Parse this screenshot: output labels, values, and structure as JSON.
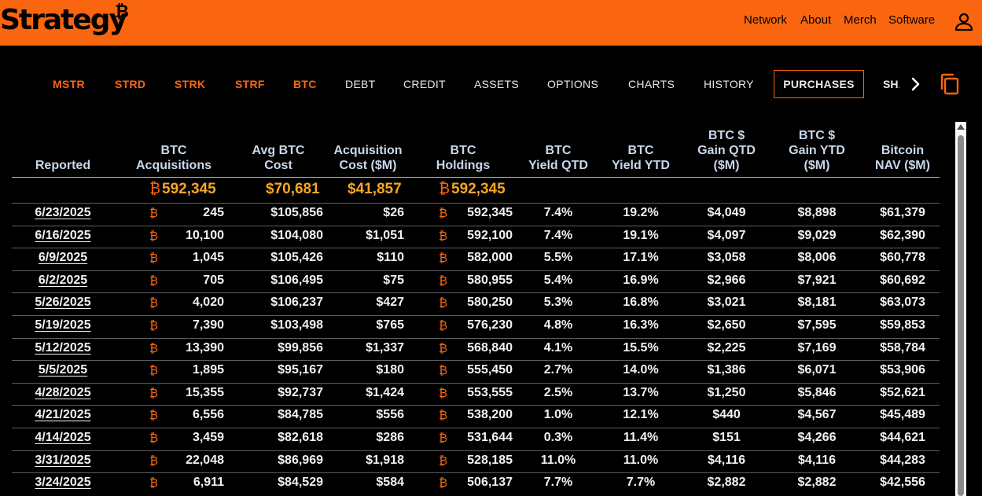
{
  "brand": {
    "name": "Strategy",
    "mark": "₿",
    "color": "#fa660f"
  },
  "topnav": [
    "Network",
    "About",
    "Merch",
    "Software"
  ],
  "icons": {
    "user": "user-icon",
    "next": "chevron-right-icon",
    "copy": "copy-icon",
    "bitcoin": "bitcoin-icon"
  },
  "tabs": [
    {
      "label": "MSTR"
    },
    {
      "label": "STRD"
    },
    {
      "label": "STRK"
    },
    {
      "label": "STRF"
    },
    {
      "label": "BTC"
    },
    {
      "label": "DEBT"
    },
    {
      "label": "CREDIT"
    },
    {
      "label": "ASSETS"
    },
    {
      "label": "OPTIONS"
    },
    {
      "label": "CHARTS"
    },
    {
      "label": "HISTORY"
    },
    {
      "label": "PURCHASES",
      "active": true
    },
    {
      "label": "SHARES",
      "clipped": "SH..."
    }
  ],
  "table": {
    "headers": [
      "Reported",
      "BTC\nAcquisitions",
      "Avg BTC\nCost",
      "Acquisition\nCost ($M)",
      "BTC\nHoldings",
      "BTC\nYield QTD",
      "BTC\nYield YTD",
      "BTC $\nGain QTD\n($M)",
      "BTC $\nGain YTD\n($M)",
      "Bitcoin\nNAV ($M)"
    ],
    "totals": {
      "acquisitions": "592,345",
      "avg_cost": "$70,681",
      "acq_cost": "$41,857",
      "holdings": "592,345"
    },
    "rows": [
      [
        "6/23/2025",
        "245",
        "$105,856",
        "$26",
        "592,345",
        "7.4%",
        "19.2%",
        "$4,049",
        "$8,898",
        "$61,379"
      ],
      [
        "6/16/2025",
        "10,100",
        "$104,080",
        "$1,051",
        "592,100",
        "7.4%",
        "19.1%",
        "$4,097",
        "$9,029",
        "$62,390"
      ],
      [
        "6/9/2025",
        "1,045",
        "$105,426",
        "$110",
        "582,000",
        "5.5%",
        "17.1%",
        "$3,058",
        "$8,006",
        "$60,778"
      ],
      [
        "6/2/2025",
        "705",
        "$106,495",
        "$75",
        "580,955",
        "5.4%",
        "16.9%",
        "$2,966",
        "$7,921",
        "$60,692"
      ],
      [
        "5/26/2025",
        "4,020",
        "$106,237",
        "$427",
        "580,250",
        "5.3%",
        "16.8%",
        "$3,021",
        "$8,181",
        "$63,073"
      ],
      [
        "5/19/2025",
        "7,390",
        "$103,498",
        "$765",
        "576,230",
        "4.8%",
        "16.3%",
        "$2,650",
        "$7,595",
        "$59,853"
      ],
      [
        "5/12/2025",
        "13,390",
        "$99,856",
        "$1,337",
        "568,840",
        "4.1%",
        "15.5%",
        "$2,225",
        "$7,169",
        "$58,784"
      ],
      [
        "5/5/2025",
        "1,895",
        "$95,167",
        "$180",
        "555,450",
        "2.7%",
        "14.0%",
        "$1,386",
        "$6,071",
        "$53,906"
      ],
      [
        "4/28/2025",
        "15,355",
        "$92,737",
        "$1,424",
        "553,555",
        "2.5%",
        "13.7%",
        "$1,250",
        "$5,846",
        "$52,621"
      ],
      [
        "4/21/2025",
        "6,556",
        "$84,785",
        "$556",
        "538,200",
        "1.0%",
        "12.1%",
        "$440",
        "$4,567",
        "$45,489"
      ],
      [
        "4/14/2025",
        "3,459",
        "$82,618",
        "$286",
        "531,644",
        "0.3%",
        "11.4%",
        "$151",
        "$4,266",
        "$44,621"
      ],
      [
        "3/31/2025",
        "22,048",
        "$86,969",
        "$1,918",
        "528,185",
        "11.0%",
        "11.0%",
        "$4,116",
        "$4,116",
        "$44,283"
      ],
      [
        "3/24/2025",
        "6,911",
        "$84,529",
        "$584",
        "506,137",
        "7.7%",
        "7.7%",
        "$2,882",
        "$2,882",
        "$42,556"
      ]
    ]
  }
}
